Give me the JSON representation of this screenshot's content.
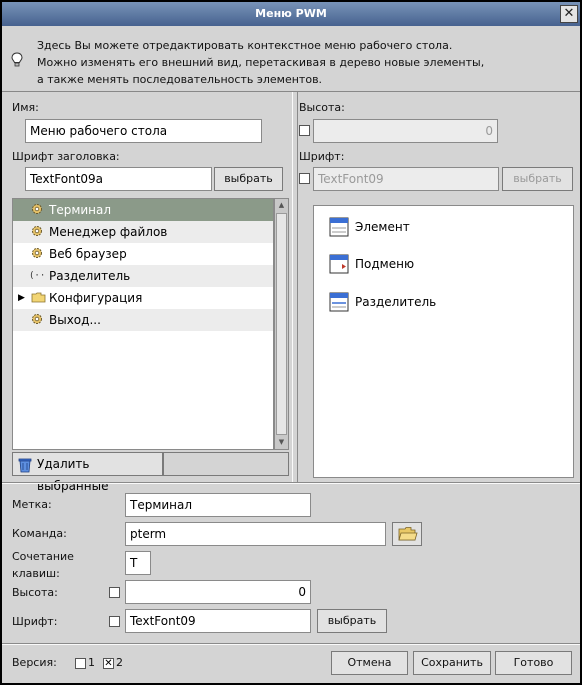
{
  "window": {
    "title": "Меню PWM",
    "close_label": "✕"
  },
  "info": {
    "lines": [
      "Здесь Вы можете отредактировать контекстное меню рабочего стола.",
      "Можно изменять его внешний вид, перетаскивая в дерево новые элементы,",
      "а также менять последовательность элементов."
    ]
  },
  "left_panel": {
    "name_label": "Имя:",
    "name_value": "Меню рабочего стола",
    "title_font_label": "Шрифт заголовка:",
    "title_font_value": "TextFont09a",
    "choose_label": "выбрать"
  },
  "right_panel": {
    "height_label": "Высота:",
    "height_value": "0",
    "font_label": "Шрифт:",
    "font_value": "TextFont09",
    "choose_label": "выбрать"
  },
  "tree": {
    "items": [
      {
        "label": "Терминал",
        "icon": "gear-icon"
      },
      {
        "label": "Менеджер файлов",
        "icon": "gear-icon"
      },
      {
        "label": "Веб браузер",
        "icon": "gear-icon"
      },
      {
        "label": "Разделитель",
        "icon": "separator-icon"
      },
      {
        "label": "Конфигурация",
        "icon": "folder-icon"
      },
      {
        "label": "Выход...",
        "icon": "gear-icon"
      }
    ],
    "delete_label": "Удалить выбранные"
  },
  "palette": {
    "items": [
      {
        "label": "Элемент",
        "icon": "element-icon"
      },
      {
        "label": "Подменю",
        "icon": "submenu-icon"
      },
      {
        "label": "Разделитель",
        "icon": "separator-doc-icon"
      }
    ]
  },
  "properties": {
    "label_label": "Метка:",
    "label_value": "Терминал",
    "command_label": "Команда:",
    "command_value": "pterm",
    "shortcut_label_1": "Сочетание",
    "shortcut_label_2": "клавиш:",
    "shortcut_value": "T",
    "height_label": "Высота:",
    "height_value": "0",
    "font_label": "Шрифт:",
    "font_value": "TextFont09",
    "choose_label": "выбрать"
  },
  "footer": {
    "version_label": "Версия:",
    "v1_label": "1",
    "v2_label": "2",
    "v2_mark": "✕",
    "cancel_label": "Отмена",
    "save_label": "Сохранить",
    "done_label": "Готово"
  },
  "colors": {
    "title_bar": "#5a75a0",
    "selection": "#8b9a89",
    "icon_blue": "#3b6fd4",
    "folder_yellow": "#f2d574"
  }
}
